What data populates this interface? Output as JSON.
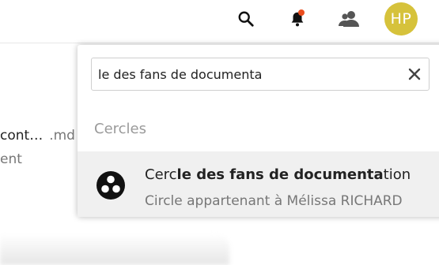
{
  "header": {
    "search_icon": "search-icon",
    "notifications_icon": "bell-icon",
    "contacts_icon": "contacts-icon",
    "notification_dot_color": "#ea4d1e",
    "avatar": {
      "initials": "HP",
      "color": "#d6c23b"
    }
  },
  "background": {
    "file_name": "cont…",
    "file_ext": ".md",
    "second_line": "ent"
  },
  "search": {
    "value": "le des fans de documenta",
    "clear_icon": "close-icon"
  },
  "results": {
    "section_label": "Cercles",
    "items": [
      {
        "title_prefix": "Cerc",
        "title_match": "le des fans de documenta",
        "title_suffix": "tion",
        "subtitle": "Circle appartenant à Mélissa RICHARD",
        "icon": "circles-icon"
      }
    ]
  }
}
